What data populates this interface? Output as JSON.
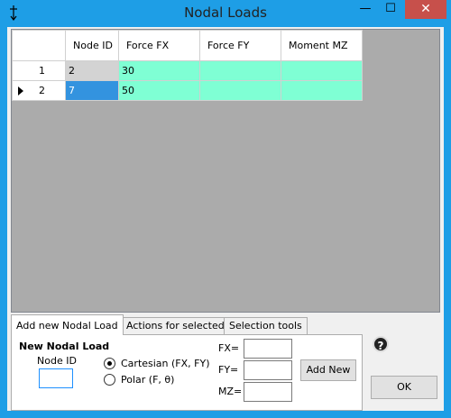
{
  "window": {
    "title": "Nodal Loads",
    "app_icon": "pin-icon",
    "minimize_glyph": "—",
    "maximize_glyph": "☐",
    "close_glyph": "✕"
  },
  "grid": {
    "columns": [
      "",
      "Node ID",
      "Force FX",
      "Force FY",
      "Moment MZ"
    ],
    "rows": [
      {
        "num": "1",
        "node_id": "2",
        "fx": "30",
        "fy": "",
        "mz": ""
      },
      {
        "num": "2",
        "node_id": "7",
        "fx": "50",
        "fy": "",
        "mz": ""
      }
    ],
    "current_row_index": 1
  },
  "tabs": [
    "Add new Nodal Load",
    "Actions for selected",
    "Selection tools"
  ],
  "form": {
    "group_title": "New Nodal Load",
    "node_id_label": "Node ID",
    "node_id_value": "",
    "radio_cartesian": "Cartesian (FX, FY)",
    "radio_polar": "Polar (F, θ)",
    "selected_mode": "cartesian",
    "fx_label": "FX=",
    "fy_label": "FY=",
    "mz_label": "MZ=",
    "fx_value": "",
    "fy_value": "",
    "mz_value": "",
    "add_button": "Add New"
  },
  "help_glyph": "?",
  "ok_button": "OK",
  "colors": {
    "titlebar": "#1e9ee6",
    "close_button": "#c7504b",
    "grid_background": "#ababab",
    "mint_cell": "#7fffd4",
    "selected_cell": "#3393df",
    "readonly_cell": "#d3d3d3"
  }
}
